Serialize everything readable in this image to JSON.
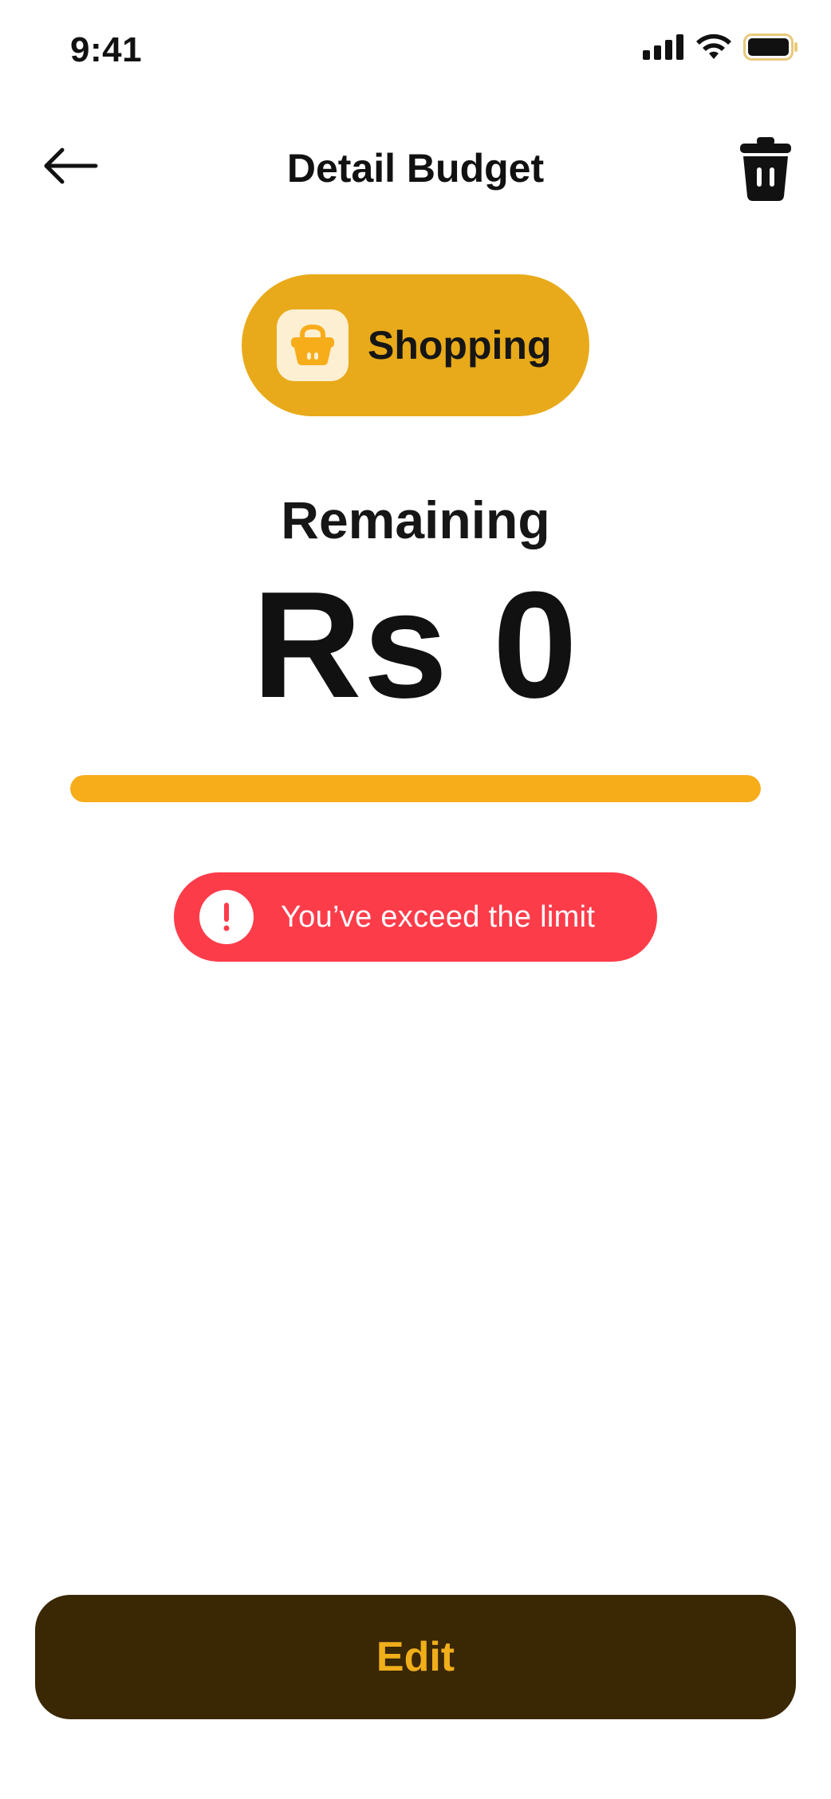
{
  "status_bar": {
    "time": "9:41"
  },
  "header": {
    "title": "Detail Budget",
    "back_icon": "arrow-left-icon",
    "delete_icon": "trash-icon"
  },
  "category": {
    "label": "Shopping",
    "icon": "shopping-basket-icon",
    "chip_color": "#E8AA1A"
  },
  "summary": {
    "remaining_label": "Remaining",
    "amount": "Rs 0",
    "progress_fraction": 1.0,
    "progress_color": "#F7AC1A"
  },
  "alert": {
    "text": "You’ve exceed the limit",
    "icon": "exclamation-icon",
    "color": "#FD3C4A"
  },
  "actions": {
    "edit_label": "Edit"
  }
}
